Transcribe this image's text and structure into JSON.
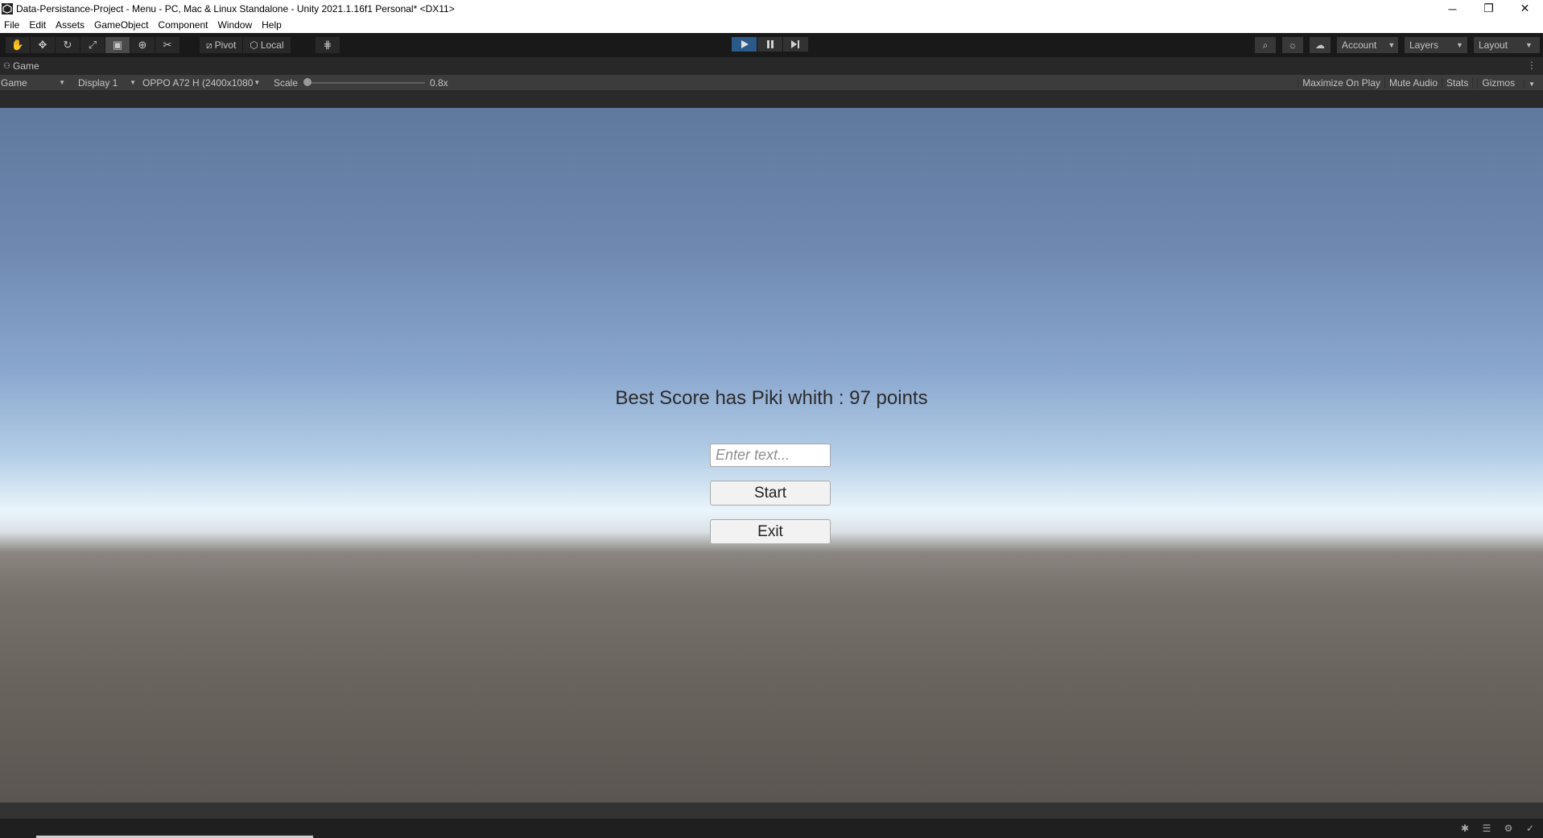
{
  "window": {
    "title": "Data-Persistance-Project - Menu - PC, Mac & Linux Standalone - Unity 2021.1.16f1 Personal* <DX11>",
    "minimize": "─",
    "restore": "❐",
    "close": "✕"
  },
  "menu": [
    "File",
    "Edit",
    "Assets",
    "GameObject",
    "Component",
    "Window",
    "Help"
  ],
  "toolbar": {
    "pivot_label": "Pivot",
    "local_label": "Local",
    "account_label": "Account",
    "layers_label": "Layers",
    "layout_label": "Layout"
  },
  "game_panel": {
    "tab_label": "Game",
    "view_mode": "Game",
    "display": "Display 1",
    "resolution": "OPPO A72 H (2400x1080",
    "scale_label": "Scale",
    "scale_value": "0.8x",
    "scale_slider_fraction": 0.0,
    "maximize_on_play": "Maximize On Play",
    "mute_audio": "Mute Audio",
    "stats": "Stats",
    "gizmos": "Gizmos"
  },
  "game": {
    "best_score_text": "Best Score has Piki whith : 97 points",
    "name_placeholder": "Enter text...",
    "start_label": "Start",
    "exit_label": "Exit"
  },
  "colors": {
    "play_active": "#2b5a8a",
    "editor_dark": "#191919",
    "panel_bg": "#3c3c3c"
  }
}
